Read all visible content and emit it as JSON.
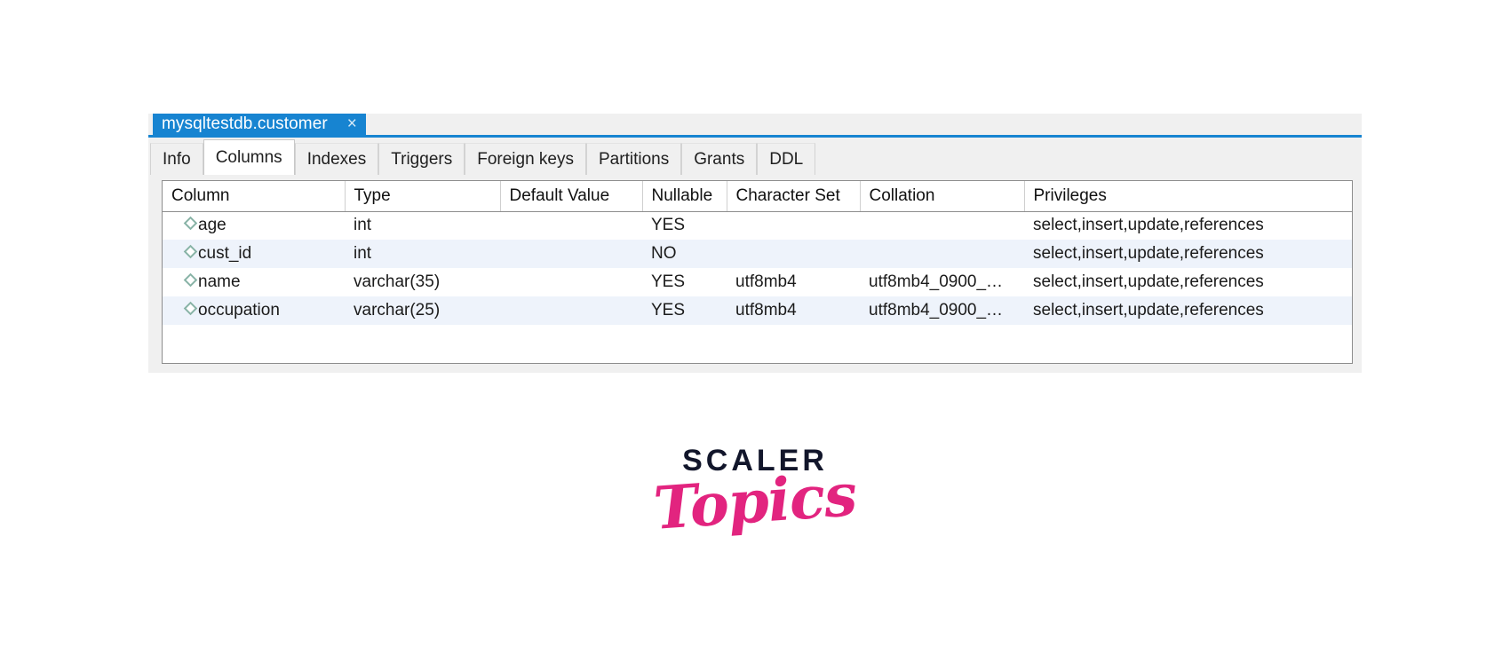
{
  "window": {
    "document_tab": {
      "label": "mysqltestdb.customer",
      "close_icon": "close-icon",
      "close_glyph": "×"
    },
    "subtabs": [
      {
        "label": "Info",
        "active": false
      },
      {
        "label": "Columns",
        "active": true
      },
      {
        "label": "Indexes",
        "active": false
      },
      {
        "label": "Triggers",
        "active": false
      },
      {
        "label": "Foreign keys",
        "active": false
      },
      {
        "label": "Partitions",
        "active": false
      },
      {
        "label": "Grants",
        "active": false
      },
      {
        "label": "DDL",
        "active": false
      }
    ]
  },
  "grid": {
    "headers": [
      "Column",
      "Type",
      "Default Value",
      "Nullable",
      "Character Set",
      "Collation",
      "Privileges"
    ],
    "rows": [
      {
        "icon": "diamond-icon",
        "column": "age",
        "type": "int",
        "default_value": "",
        "nullable": "YES",
        "character_set": "",
        "collation": "",
        "privileges": "select,insert,update,references"
      },
      {
        "icon": "diamond-icon",
        "column": "cust_id",
        "type": "int",
        "default_value": "",
        "nullable": "NO",
        "character_set": "",
        "collation": "",
        "privileges": "select,insert,update,references"
      },
      {
        "icon": "diamond-icon",
        "column": "name",
        "type": "varchar(35)",
        "default_value": "",
        "nullable": "YES",
        "character_set": "utf8mb4",
        "collation": "utf8mb4_0900_…",
        "privileges": "select,insert,update,references"
      },
      {
        "icon": "diamond-icon",
        "column": "occupation",
        "type": "varchar(25)",
        "default_value": "",
        "nullable": "YES",
        "character_set": "utf8mb4",
        "collation": "utf8mb4_0900_…",
        "privileges": "select,insert,update,references"
      }
    ]
  },
  "logo": {
    "primary": "SCALER",
    "secondary": "Topics"
  },
  "colors": {
    "tab_active_blue": "#1784d1",
    "row_alt": "#eef3fb",
    "icon_teal": "#88b3a6",
    "logo_dark": "#12162b",
    "logo_pink": "#e2247f"
  }
}
